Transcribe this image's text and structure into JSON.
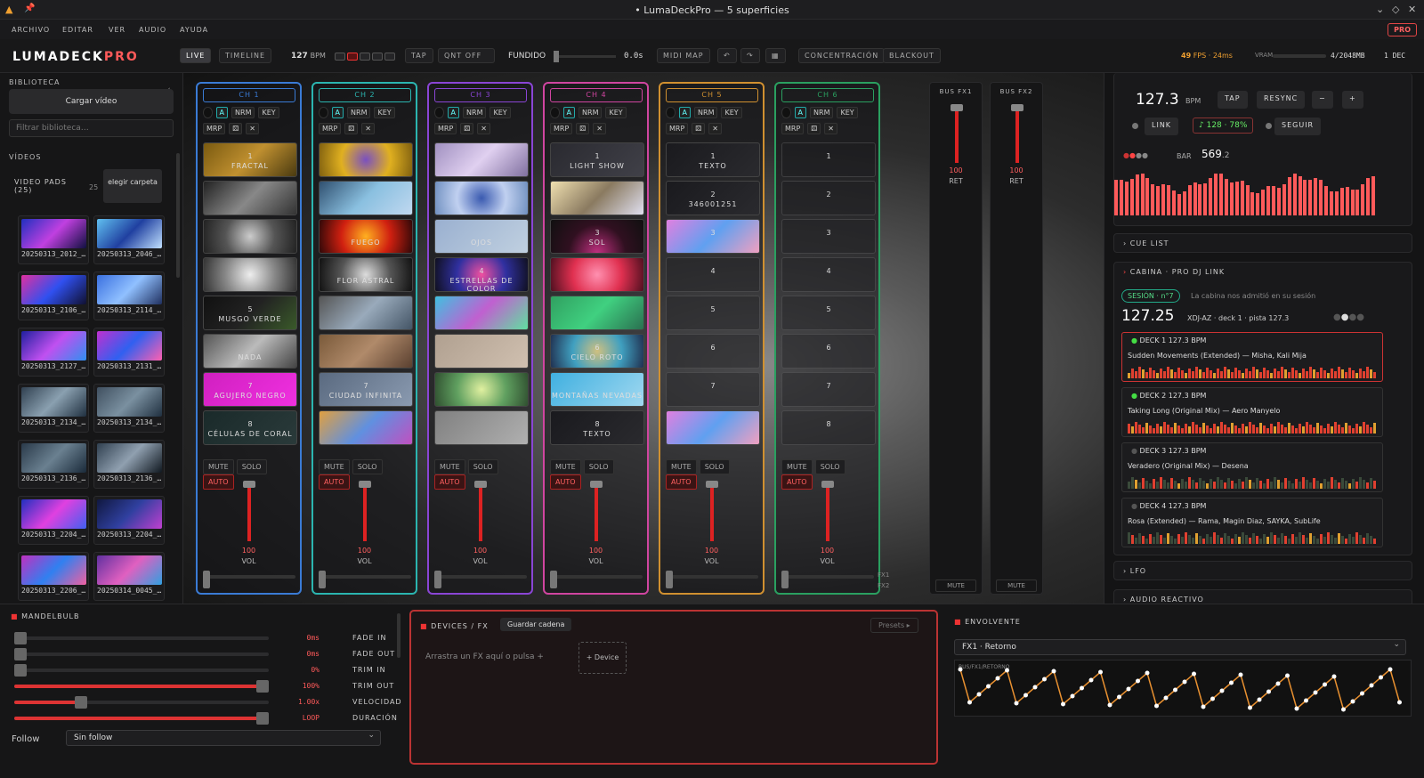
{
  "window": {
    "title": "• LumaDeckPro — 5 superficies"
  },
  "menu": [
    "ARCHIVO",
    "EDITAR",
    "VER",
    "AUDIO",
    "AYUDA"
  ],
  "pro_badge": "PRO",
  "toolbar": {
    "logo_a": "LUMADECK",
    "logo_b": "PRO",
    "live": "LIVE",
    "timeline": "TIMELINE",
    "bpm": "127",
    "bpm_unit": "BPM",
    "tap": "TAP",
    "qnt": "QNT OFF",
    "fundido": "FUNDIDO",
    "fade_time": "0.0s",
    "midi_map": "MIDI MAP",
    "concentracion": "CONCENTRACIÓN",
    "blackout": "BLACKOUT",
    "fps": "49",
    "fps_unit": "FPS · 24ms",
    "vram": "VRAM",
    "vram_val": "4/2048MB",
    "dec": "1 DEC"
  },
  "sidebar": {
    "biblioteca": "BIBLIOTECA",
    "cargar": "Cargar vídeo",
    "filter_placeholder": "Filtrar biblioteca…",
    "videos": "VÍDEOS",
    "pads_label": "VIDEO PADS (25)",
    "pads_count": "25",
    "elegir": "elegir carpeta",
    "thumbs": [
      "20250313_2012_…",
      "20250313_2046_…",
      "20250313_2106_…",
      "20250313_2114_…",
      "20250313_2127_…",
      "20250313_2131_…",
      "20250313_2134_…",
      "20250313_2134_…",
      "20250313_2136_…",
      "20250313_2136_…",
      "20250313_2204_…",
      "20250313_2204_…",
      "20250313_2206_…",
      "20250314_0045_…"
    ]
  },
  "channels": [
    {
      "label": "CH 1",
      "color": "#3a7bd5",
      "pads": [
        {
          "n": "1",
          "t": "FRACTAL",
          "bg": "linear-gradient(135deg,#7a5a10,#c09030,#4a3a10)"
        },
        {
          "n": "",
          "t": "",
          "bg": "linear-gradient(135deg,#222,#888,#333)"
        },
        {
          "n": "",
          "t": "",
          "bg": "radial-gradient(circle,#ccc,#555,#222)"
        },
        {
          "n": "",
          "t": "",
          "bg": "radial-gradient(circle,#eee,#888,#333)"
        },
        {
          "n": "5",
          "t": "MUSGO VERDE",
          "bg": "linear-gradient(135deg,#111,#222,#3a5a2a)"
        },
        {
          "n": "",
          "t": "NADA",
          "bg": "linear-gradient(135deg,#555,#bbb,#444)"
        },
        {
          "n": "7",
          "t": "AGUJERO NEGRO",
          "bg": "linear-gradient(135deg,#d020c0,#f030e0)"
        },
        {
          "n": "8",
          "t": "CÉLULAS DE CORAL",
          "bg": "linear-gradient(135deg,#1a2a2a,#2a3a3a)"
        }
      ]
    },
    {
      "label": "CH 2",
      "color": "#2bb5b0",
      "pads": [
        {
          "n": "",
          "t": "",
          "bg": "radial-gradient(circle,#7a50c0,#e0b020,#806010)"
        },
        {
          "n": "",
          "t": "",
          "bg": "linear-gradient(135deg,#305070,#8ac0e0,#c0d8f0)"
        },
        {
          "n": "",
          "t": "FUEGO",
          "bg": "radial-gradient(circle,#ffb020,#d02010,#300808)"
        },
        {
          "n": "",
          "t": "FLOR ASTRAL",
          "bg": "radial-gradient(circle,#ddd,#555,#111)"
        },
        {
          "n": "",
          "t": "",
          "bg": "linear-gradient(135deg,#555,#9ab,#456)"
        },
        {
          "n": "",
          "t": "",
          "bg": "linear-gradient(135deg,#7a5a3a,#b08a6a,#5a4030)"
        },
        {
          "n": "7",
          "t": "CIUDAD INFINITA",
          "bg": "linear-gradient(135deg,#5a6a80,#8a9ab0)"
        },
        {
          "n": "",
          "t": "",
          "bg": "linear-gradient(135deg,#e0a040,#6090e0,#c050c0)"
        }
      ]
    },
    {
      "label": "CH 3",
      "color": "#8a45d5",
      "pads": [
        {
          "n": "",
          "t": "",
          "bg": "linear-gradient(135deg,#a090c0,#e0d0f0,#8070a0)"
        },
        {
          "n": "",
          "t": "",
          "bg": "radial-gradient(circle,#3a5ab0,#c0d0f0,#7090c0)"
        },
        {
          "n": "",
          "t": "OJOS",
          "bg": "linear-gradient(135deg,#9ab0d0,#c0d0e0)"
        },
        {
          "n": "4",
          "t": "ESTRELLAS DE COLOR",
          "bg": "radial-gradient(circle,#f050a0,#3030a0,#101020)"
        },
        {
          "n": "",
          "t": "",
          "bg": "linear-gradient(135deg,#40c0e0,#c060d0,#60e0a0)"
        },
        {
          "n": "",
          "t": "",
          "bg": "linear-gradient(135deg,#b0a090,#d0c0b0)"
        },
        {
          "n": "",
          "t": "",
          "bg": "radial-gradient(circle,#e0f0a0,#60a060,#305030)"
        },
        {
          "n": "",
          "t": "",
          "bg": "linear-gradient(135deg,#808080,#b0b0b0)"
        }
      ]
    },
    {
      "label": "CH 4",
      "color": "#d045a0",
      "pads": [
        {
          "n": "1",
          "t": "LIGHT SHOW",
          "bg": "linear-gradient(135deg,#2a2a30,#404048)"
        },
        {
          "n": "",
          "t": "",
          "bg": "linear-gradient(135deg,#f0e0b0,#8a7a60,#e0e0f0)"
        },
        {
          "n": "3",
          "t": "SOL",
          "bg": "radial-gradient(circle at 50% 100%,#c03080,#301020,#101010)"
        },
        {
          "n": "",
          "t": "",
          "bg": "radial-gradient(circle,#ff90b0,#e03050,#501020)"
        },
        {
          "n": "",
          "t": "",
          "bg": "linear-gradient(135deg,#30a060,#40d080,#2a7050)"
        },
        {
          "n": "6",
          "t": "CIELO ROTO",
          "bg": "radial-gradient(circle,#d0c080,#40a0c0,#203050)"
        },
        {
          "n": "",
          "t": "MONTAÑAS NEVADAS",
          "bg": "linear-gradient(135deg,#40b0e0,#a0d8f0)"
        },
        {
          "n": "8",
          "t": "TEXTO",
          "bg": "linear-gradient(135deg,#1a1a1e,#2a2a2e)"
        }
      ]
    },
    {
      "label": "CH 5",
      "color": "#d09030",
      "pads": [
        {
          "n": "1",
          "t": "TEXTO",
          "bg": "linear-gradient(135deg,#1a1a1e,#2a2a2e)"
        },
        {
          "n": "2",
          "t": "346001251",
          "bg": "linear-gradient(135deg,#1a1a1e,#2a2a2e)"
        },
        {
          "n": "3",
          "t": "",
          "bg": "linear-gradient(135deg,#e080e0,#60a0f0,#f0a0c0)"
        },
        {
          "n": "4",
          "t": "",
          "bg": "empty"
        },
        {
          "n": "5",
          "t": "",
          "bg": "empty"
        },
        {
          "n": "6",
          "t": "",
          "bg": "empty"
        },
        {
          "n": "7",
          "t": "",
          "bg": "empty"
        },
        {
          "n": "",
          "t": "",
          "bg": "linear-gradient(135deg,#e080e0,#60a0f0,#f0a0c0)"
        }
      ]
    },
    {
      "label": "CH 6",
      "color": "#2aa060",
      "pads": [
        {
          "n": "1",
          "t": "",
          "bg": "empty"
        },
        {
          "n": "2",
          "t": "",
          "bg": "empty"
        },
        {
          "n": "3",
          "t": "",
          "bg": "empty"
        },
        {
          "n": "4",
          "t": "",
          "bg": "empty"
        },
        {
          "n": "5",
          "t": "",
          "bg": "empty"
        },
        {
          "n": "6",
          "t": "",
          "bg": "empty"
        },
        {
          "n": "7",
          "t": "",
          "bg": "empty"
        },
        {
          "n": "8",
          "t": "",
          "bg": "empty"
        }
      ]
    }
  ],
  "channel_buttons": {
    "a": "A",
    "nrm": "NRM",
    "key": "KEY",
    "mrp": "MRP",
    "mute": "MUTE",
    "solo": "SOLO",
    "auto": "AUTO",
    "vol": "VOL",
    "vol_val": "100",
    "fx1": "FX1",
    "fx2": "FX2"
  },
  "buses": [
    {
      "label": "BUS FX1",
      "val": "100",
      "ret": "RET",
      "mute": "MUTE"
    },
    {
      "label": "BUS FX2",
      "val": "100",
      "ret": "RET",
      "mute": "MUTE"
    }
  ],
  "right": {
    "bpm": "127.3",
    "bpm_unit": "BPM",
    "tap": "TAP",
    "resync": "RESYNC",
    "minus": "−",
    "plus": "+",
    "link": "LINK",
    "link_val": "♪ 128 · 78%",
    "seguir": "SEGUIR",
    "bar_label": "BAR",
    "bar_val": "569",
    "bar_frac": ".2",
    "cue_list": "CUE LIST",
    "cabina": "CABINA · PRO DJ LINK",
    "sesion": "SESIÓN · n°7",
    "sesion_msg": "La cabina nos admitió en su sesión",
    "cab_bpm": "127.25",
    "cab_info": "XDJ-AZ · deck 1 · pista 127.3",
    "decks": [
      {
        "h": "DECK 1  127.3 BPM",
        "t": "Sudden Movements (Extended) — Misha, Kali Mija",
        "dot": "#4d4"
      },
      {
        "h": "DECK 2  127.3 BPM",
        "t": "Taking Long (Original Mix) — Aero Manyelo",
        "dot": "#4d4"
      },
      {
        "h": "DECK 3  127.3 BPM",
        "t": "Veradero (Original Mix) — Desena",
        "dot": "#555"
      },
      {
        "h": "DECK 4  127.3 BPM",
        "t": "Rosa (Extended) — Rama, Magin Diaz, SAYKA, SubLife",
        "dot": "#555"
      }
    ],
    "lfo": "LFO",
    "audio_reactivo": "AUDIO REACTIVO"
  },
  "bottom": {
    "mandelbulb": "MANDELBULB",
    "params": [
      {
        "v": "0ms",
        "n": "FADE IN",
        "level": 0.0
      },
      {
        "v": "0ms",
        "n": "FADE OUT",
        "level": 0.0
      },
      {
        "v": "0%",
        "n": "TRIM IN",
        "level": 0.0
      },
      {
        "v": "100%",
        "n": "TRIM OUT",
        "level": 1.0
      },
      {
        "v": "1.00x",
        "n": "VELOCIDAD",
        "level": 0.25
      },
      {
        "v": "LOOP",
        "n": "DURACIÓN",
        "level": 1.0
      }
    ],
    "follow": "Follow",
    "follow_val": "Sin follow",
    "devices": "DEVICES / FX",
    "guardar": "Guardar cadena",
    "presets": "Presets ▸",
    "arrastra": "Arrastra un FX aquí o pulsa +",
    "device_btn": "+ Device",
    "envolvente": "ENVOLVENTE",
    "env_select": "FX1 · Retorno",
    "env_tag": "BUS/FX1/RETORNO"
  }
}
